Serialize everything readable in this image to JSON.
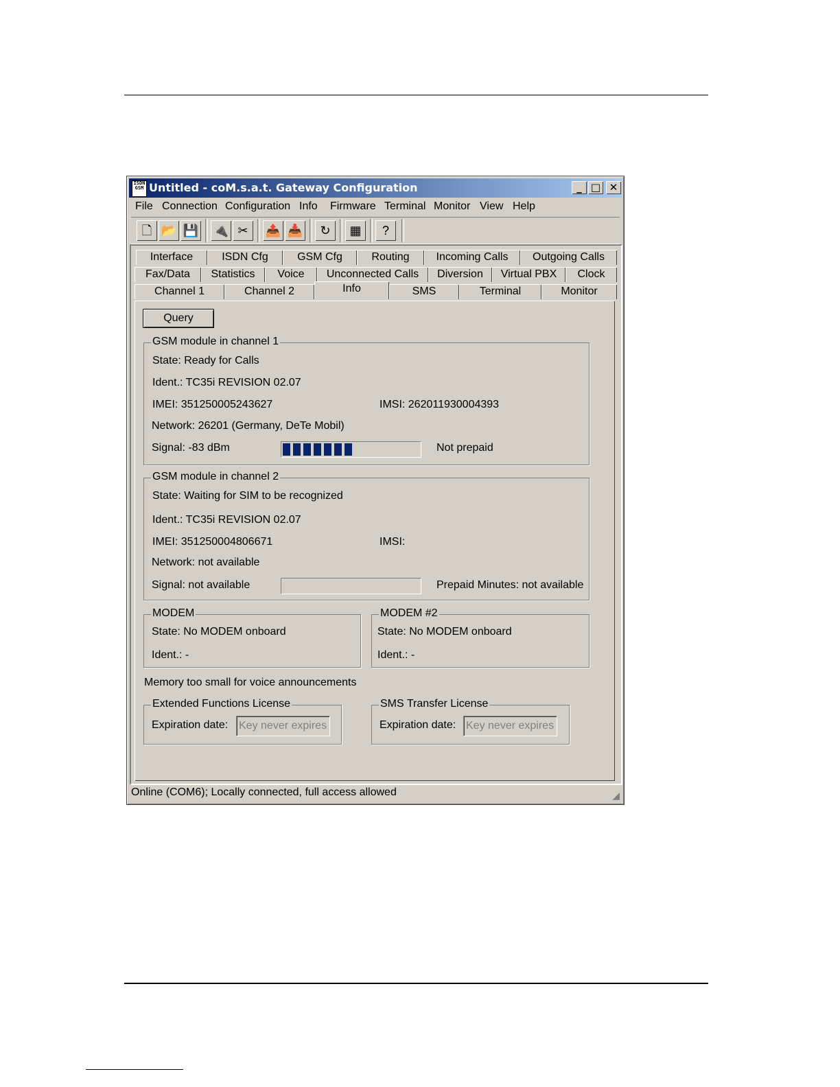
{
  "window": {
    "title": "Untitled - coM.s.a.t. Gateway Configuration",
    "app_icon_text": "ISDN GSM",
    "controls": {
      "minimize": "_",
      "maximize": "□",
      "close": "✕"
    }
  },
  "menu": [
    "File",
    "Connection",
    "Configuration",
    "Info",
    "Firmware",
    "Terminal",
    "Monitor",
    "View",
    "Help"
  ],
  "toolbar": {
    "buttons": [
      {
        "icon": "new-document-icon",
        "glyph": "🗋"
      },
      {
        "icon": "open-folder-icon",
        "glyph": "📂"
      },
      {
        "icon": "save-disk-icon",
        "glyph": "💾"
      },
      {
        "icon": "connect-icon",
        "glyph": "🔌"
      },
      {
        "icon": "disconnect-icon",
        "glyph": "✂"
      },
      {
        "icon": "upload-config-icon",
        "glyph": "📤"
      },
      {
        "icon": "download-config-icon",
        "glyph": "📥"
      },
      {
        "icon": "refresh-icon",
        "glyph": "↻"
      },
      {
        "icon": "firmware-chip-icon",
        "glyph": "▦"
      },
      {
        "icon": "help-icon",
        "glyph": "?"
      }
    ]
  },
  "tabs": {
    "row1": [
      "Interface",
      "ISDN Cfg",
      "GSM Cfg",
      "Routing",
      "Incoming Calls",
      "Outgoing Calls"
    ],
    "row2": [
      "Fax/Data",
      "Statistics",
      "Voice",
      "Unconnected Calls",
      "Diversion",
      "Virtual PBX",
      "Clock"
    ],
    "row3": [
      "Channel 1",
      "Channel 2",
      "Info",
      "SMS",
      "Terminal",
      "Monitor"
    ],
    "active": "Info"
  },
  "info": {
    "query_label": "Query",
    "gsm1": {
      "title": "GSM module in channel 1",
      "state": "State: Ready for Calls",
      "ident": "Ident.: TC35i REVISION 02.07",
      "imei": "IMEI: 351250005243627",
      "imsi": "IMSI: 262011930004393",
      "network": "Network: 26201 (Germany, DeTe Mobil)",
      "signal": "Signal: -83 dBm",
      "signal_level": 0.52,
      "prepaid": "Not prepaid"
    },
    "gsm2": {
      "title": "GSM module in channel 2",
      "state": "State: Waiting for SIM to be recognized",
      "ident": "Ident.: TC35i REVISION 02.07",
      "imei": "IMEI: 351250004806671",
      "imsi": "IMSI:",
      "network": "Network: not available",
      "signal": "Signal: not available",
      "signal_level": 0,
      "prepaid": "Prepaid Minutes: not available"
    },
    "modem1": {
      "title": "MODEM",
      "state": "State: No MODEM onboard",
      "ident": "Ident.: -"
    },
    "modem2": {
      "title": "MODEM #2",
      "state": "State: No MODEM onboard",
      "ident": "Ident.: -"
    },
    "memory_note": "Memory too small for voice announcements",
    "ext_license": {
      "title": "Extended Functions License",
      "label": "Expiration date:",
      "value": "Key never expires"
    },
    "sms_license": {
      "title": "SMS Transfer License",
      "label": "Expiration date:",
      "value": "Key never expires"
    }
  },
  "status": "Online (COM6); Locally connected, full access allowed"
}
